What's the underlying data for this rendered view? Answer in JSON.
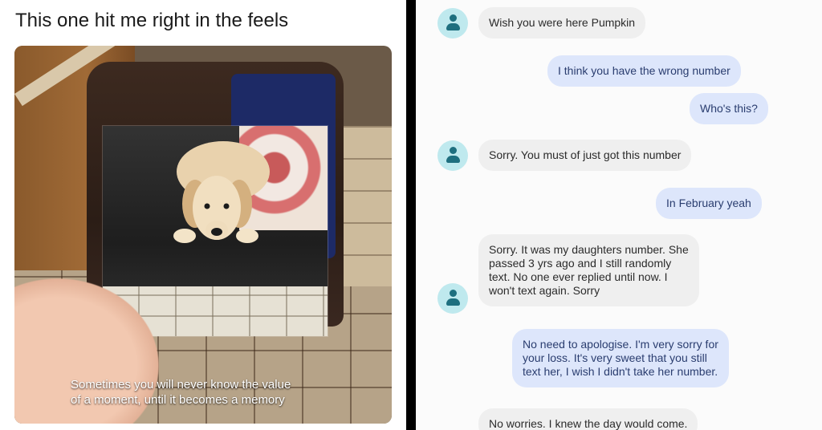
{
  "left": {
    "title": "This one hit me right in the feels",
    "caption_line1": "Sometimes you will never know the value",
    "caption_line2": "of a moment, until it becomes a memory"
  },
  "chat": {
    "messages": [
      {
        "dir": "in",
        "text": "Wish you were here Pumpkin"
      },
      {
        "dir": "out",
        "text": "I think you have the wrong number"
      },
      {
        "dir": "out",
        "text": "Who's this?"
      },
      {
        "dir": "in",
        "text": "Sorry. You must of just got this number"
      },
      {
        "dir": "out",
        "text": "In February yeah"
      },
      {
        "dir": "in",
        "lines": [
          "Sorry. It was my daughters number. She",
          "passed 3 yrs ago and I still randomly",
          "text. No one ever replied until now.  I",
          "won't text again. Sorry"
        ]
      },
      {
        "dir": "out",
        "lines": [
          "No need to apologise. I'm very sorry for",
          "your loss. It's very sweet that you still",
          "text her, I wish I didn't take her number."
        ]
      },
      {
        "dir": "in",
        "text": "No worries. I knew the day would come."
      }
    ]
  },
  "colors": {
    "incoming_bubble": "#efefef",
    "outgoing_bubble": "#dde6fb",
    "avatar_bg": "#bfe9ee",
    "avatar_fg": "#1e6f7f"
  }
}
